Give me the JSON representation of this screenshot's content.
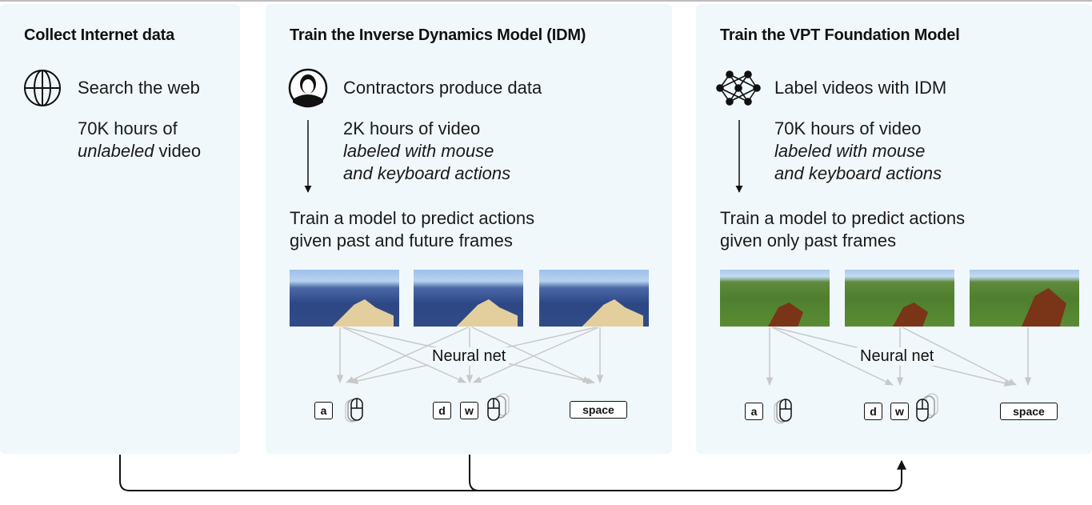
{
  "colors": {
    "panel": "#f1f8fc",
    "arrow_gray": "#c8c8c8",
    "text": "#111111"
  },
  "panels": [
    {
      "title": "Collect Internet data",
      "icon": "globe-icon",
      "step": "Search the web",
      "detail_1": "70K hours of",
      "detail_2_italic": "unlabeled",
      "detail_2_rest": " video"
    },
    {
      "title": "Train the Inverse Dynamics Model (IDM)",
      "icon": "person-icon",
      "step": "Contractors produce data",
      "detail_1": "2K hours of video",
      "detail_2": "labeled with mouse",
      "detail_3": "and keyboard actions",
      "train_1": "Train a model to predict actions",
      "train_2": "given past and future frames",
      "net_label": "Neural net",
      "keys": [
        "a",
        "d",
        "w",
        "space"
      ]
    },
    {
      "title": "Train the VPT Foundation Model",
      "icon": "neural-network-icon",
      "step": "Label videos with IDM",
      "detail_1": "70K hours of video",
      "detail_2": "labeled with mouse",
      "detail_3": "and keyboard actions",
      "train_1": "Train a model to predict actions",
      "train_2": "given only past frames",
      "net_label": "Neural net",
      "keys": [
        "a",
        "d",
        "w",
        "space"
      ]
    }
  ]
}
